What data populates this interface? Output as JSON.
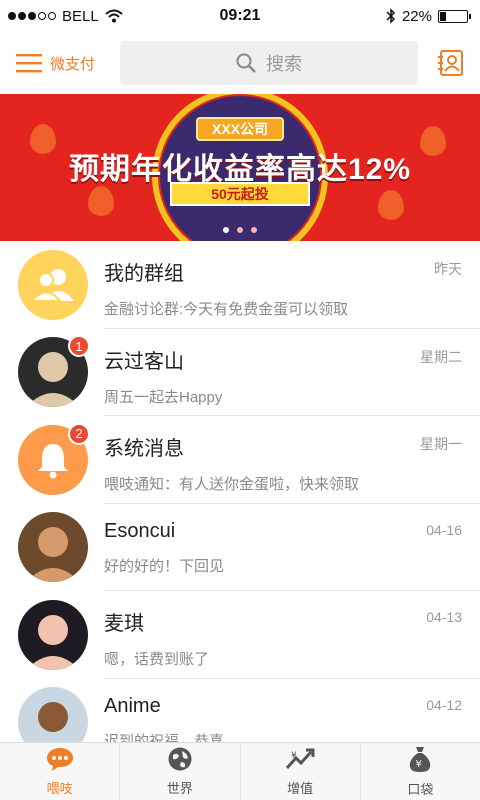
{
  "status_bar": {
    "carrier": "BELL",
    "time": "09:21",
    "battery_percent": "22%",
    "battery_level": 0.22
  },
  "header": {
    "menu_label": "微支付",
    "search_placeholder": "搜索"
  },
  "banner": {
    "tag": "XXX公司",
    "title": "预期年化收益率高达12%",
    "subtitle": "50元起投",
    "page_count": 3,
    "active_page": 0
  },
  "conversations": [
    {
      "title": "我的群组",
      "preview": "金融讨论群:今天有免费金蛋可以领取",
      "time": "昨天",
      "badge": "",
      "avatar": "group-icon"
    },
    {
      "title": "云过客山",
      "preview": "周五一起去Happy",
      "time": "星期二",
      "badge": "1",
      "avatar": "user-photo"
    },
    {
      "title": "系统消息",
      "preview": "喂吱通知：有人送你金蛋啦，快来领取",
      "time": "星期一",
      "badge": "2",
      "avatar": "bell-icon"
    },
    {
      "title": "Esoncui",
      "preview": "好的好的！下回见",
      "time": "04-16",
      "badge": "",
      "avatar": "user-photo"
    },
    {
      "title": "麦琪",
      "preview": "嗯，话费到账了",
      "time": "04-13",
      "badge": "",
      "avatar": "user-photo"
    },
    {
      "title": "Anime",
      "preview": "迟到的祝福，恭喜",
      "time": "04-12",
      "badge": "",
      "avatar": "user-photo"
    }
  ],
  "tabs": [
    {
      "label": "喂吱",
      "icon": "chat-bubble-icon",
      "active": true
    },
    {
      "label": "世界",
      "icon": "globe-icon",
      "active": false
    },
    {
      "label": "增值",
      "icon": "growth-icon",
      "active": false
    },
    {
      "label": "口袋",
      "icon": "money-bag-icon",
      "active": false
    }
  ],
  "colors": {
    "accent": "#f07d28",
    "banner_bg": "#e4241f",
    "badge": "#ea4a30"
  }
}
